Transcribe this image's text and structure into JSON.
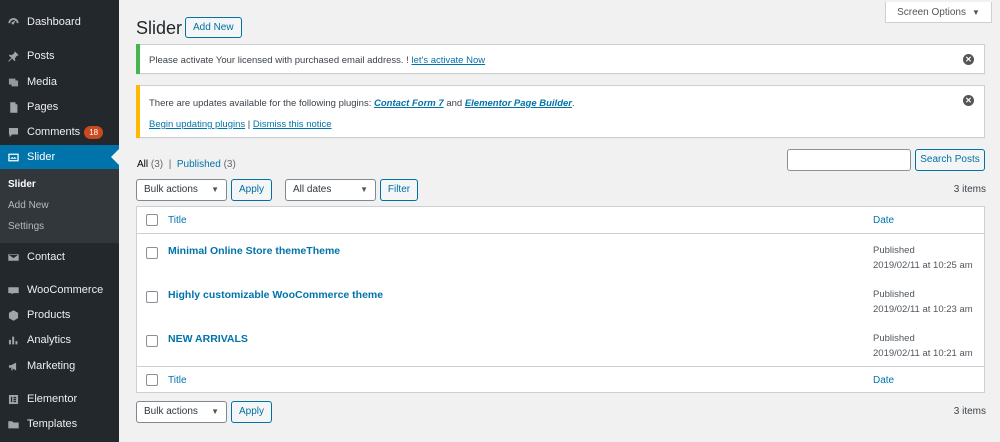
{
  "sidebar": {
    "items": [
      {
        "label": "Dashboard",
        "icon": "dashboard-icon"
      },
      {
        "label": "Posts",
        "icon": "pin-icon"
      },
      {
        "label": "Media",
        "icon": "media-icon"
      },
      {
        "label": "Pages",
        "icon": "pages-icon"
      },
      {
        "label": "Comments",
        "icon": "comment-icon",
        "badge": "18"
      },
      {
        "label": "Slider",
        "icon": "slider-icon",
        "current": true
      },
      {
        "label": "Contact",
        "icon": "mail-icon"
      },
      {
        "label": "WooCommerce",
        "icon": "woocommerce-icon"
      },
      {
        "label": "Products",
        "icon": "box-icon"
      },
      {
        "label": "Analytics",
        "icon": "bar-chart-icon"
      },
      {
        "label": "Marketing",
        "icon": "megaphone-icon"
      },
      {
        "label": "Elementor",
        "icon": "elementor-icon"
      },
      {
        "label": "Templates",
        "icon": "folder-icon"
      }
    ],
    "submenu": [
      "Slider",
      "Add New",
      "Settings"
    ]
  },
  "header": {
    "title": "Slider",
    "add_new": "Add New",
    "screen_options": "Screen Options"
  },
  "notices": {
    "license_text": "Please activate Your licensed with purchased email address. !",
    "license_link": "let's activate Now",
    "updates_text": "There are updates available for the following plugins:",
    "updates_plugin1": "Contact Form 7",
    "updates_and": "and",
    "updates_plugin2": "Elementor Page Builder",
    "begin_updating": "Begin updating plugins",
    "separator": "|",
    "dismiss": "Dismiss this notice"
  },
  "filters": {
    "all_label": "All",
    "all_count": "(3)",
    "sep": "|",
    "published_label": "Published",
    "published_count": "(3)",
    "search_button": "Search Posts",
    "bulk_actions": "Bulk actions",
    "apply": "Apply",
    "all_dates": "All dates",
    "filter": "Filter",
    "items_count": "3 items"
  },
  "table": {
    "col_title": "Title",
    "col_date": "Date",
    "rows": [
      {
        "title": "Minimal Online Store themeTheme",
        "status": "Published",
        "date": "2019/02/11 at 10:25 am"
      },
      {
        "title": "Highly customizable WooCommerce theme",
        "status": "Published",
        "date": "2019/02/11 at 10:23 am"
      },
      {
        "title": "NEW ARRIVALS",
        "status": "Published",
        "date": "2019/02/11 at 10:21 am"
      }
    ]
  },
  "colors": {
    "sidebar_bg": "#23282d",
    "accent": "#0073aa",
    "notice_success": "#46b450",
    "notice_warning": "#ffb900",
    "badge": "#ca4a1f"
  }
}
